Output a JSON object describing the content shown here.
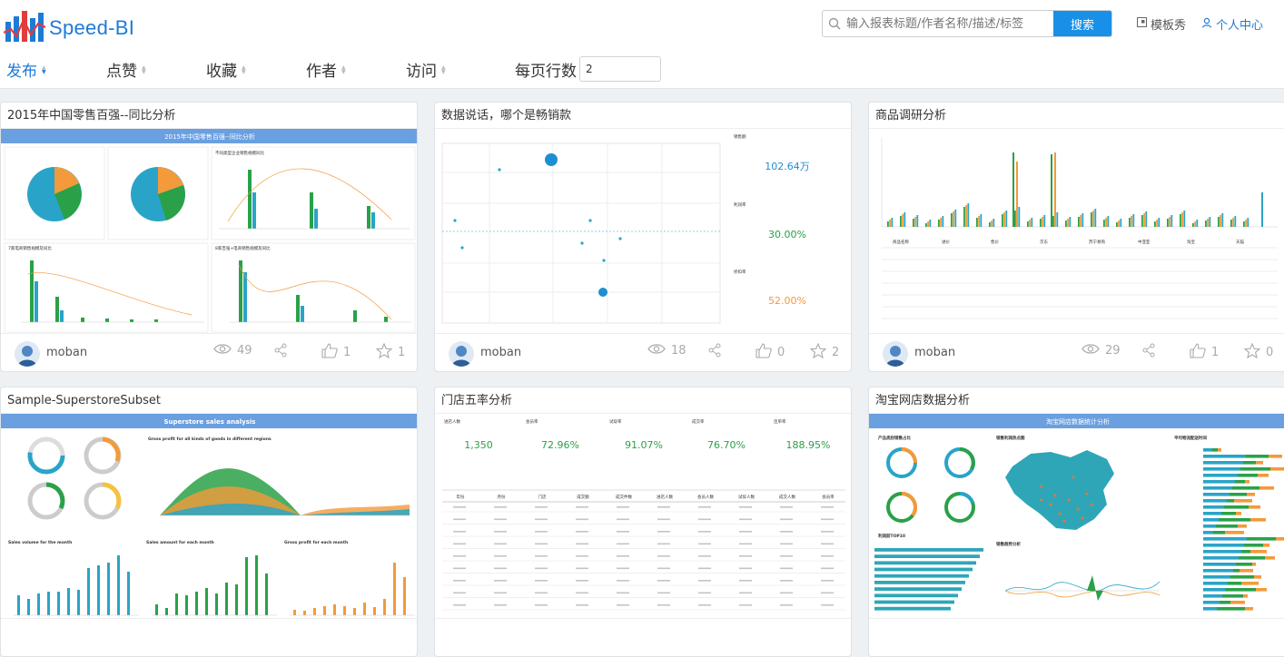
{
  "app": {
    "name": "Speed-BI"
  },
  "search": {
    "placeholder": "输入报表标题/作者名称/描述/标签",
    "button": "搜索"
  },
  "nav": {
    "templates": "模板秀",
    "profile": "个人中心"
  },
  "sort": {
    "items": [
      {
        "label": "发布",
        "active": true
      },
      {
        "label": "点赞",
        "active": false
      },
      {
        "label": "收藏",
        "active": false
      },
      {
        "label": "作者",
        "active": false
      },
      {
        "label": "访问",
        "active": false
      }
    ],
    "rows_label": "每页行数",
    "rows_value": "2"
  },
  "cards": [
    {
      "title": "2015年中国零售百强--同比分析",
      "author": "moban",
      "views": "49",
      "likes": "1",
      "favorites": "1",
      "thumb": {
        "banner": "2015年中国零售百强--同比分析",
        "c1": "不同类型企业销售规模同比",
        "c2": "7家电商销售规模及同比",
        "c3": "8家百强+电商销售规模及同比"
      }
    },
    {
      "title": "数据说话，哪个是畅销款",
      "author": "moban",
      "views": "18",
      "likes": "0",
      "favorites": "2",
      "thumb": {
        "k1_label": "销售额",
        "k1_value": "102.64万",
        "k2_label": "利润率",
        "k2_value": "30.00%",
        "k3_label": "折扣率",
        "k3_value": "52.00%"
      }
    },
    {
      "title": "商品调研分析",
      "author": "moban",
      "views": "29",
      "likes": "1",
      "favorites": "0",
      "thumb": {
        "cols": [
          "商品名称",
          "进价",
          "售价",
          "京东",
          "苏宁易购",
          "中亚亚",
          "淘宝",
          "天猫"
        ]
      }
    },
    {
      "title": "Sample-SuperstoreSubset",
      "author": "moban",
      "views": "",
      "likes": "",
      "favorites": "",
      "thumb": {
        "banner": "Superstore sales analysis",
        "c1": "Gross profit for all kinds of goods in different regions",
        "c2": "Sales volume for the month",
        "c3": "Sales amount for each month",
        "c4": "Gross profit for each month"
      }
    },
    {
      "title": "门店五率分析",
      "author": "moban",
      "views": "",
      "likes": "",
      "favorites": "",
      "thumb": {
        "kpis": [
          {
            "label": "进店人数",
            "value": "1,350"
          },
          {
            "label": "会员率",
            "value": "72.96%"
          },
          {
            "label": "试穿率",
            "value": "91.07%"
          },
          {
            "label": "成交率",
            "value": "76.70%"
          },
          {
            "label": "连单率",
            "value": "188.95%"
          }
        ],
        "cols": [
          "年份",
          "月份",
          "门店",
          "成交额",
          "成交件数",
          "进店人数",
          "会员人数",
          "试穿人数",
          "成交人数",
          "会员率"
        ]
      }
    },
    {
      "title": "淘宝网店数据分析",
      "author": "moban",
      "views": "",
      "likes": "",
      "favorites": "",
      "thumb": {
        "banner": "淘宝网店数据统计分析",
        "c1": "产品类别销售占比",
        "c2": "销售利润热点图",
        "c3": "平均物流配送时间",
        "c4": "利润前TOP10",
        "c5": "销售趋势分析"
      }
    }
  ],
  "colors": {
    "accent": "#1890e8",
    "brand": "#1e7ad7",
    "green": "#2aa148",
    "teal": "#29a4c8",
    "orange": "#f39a3a"
  }
}
